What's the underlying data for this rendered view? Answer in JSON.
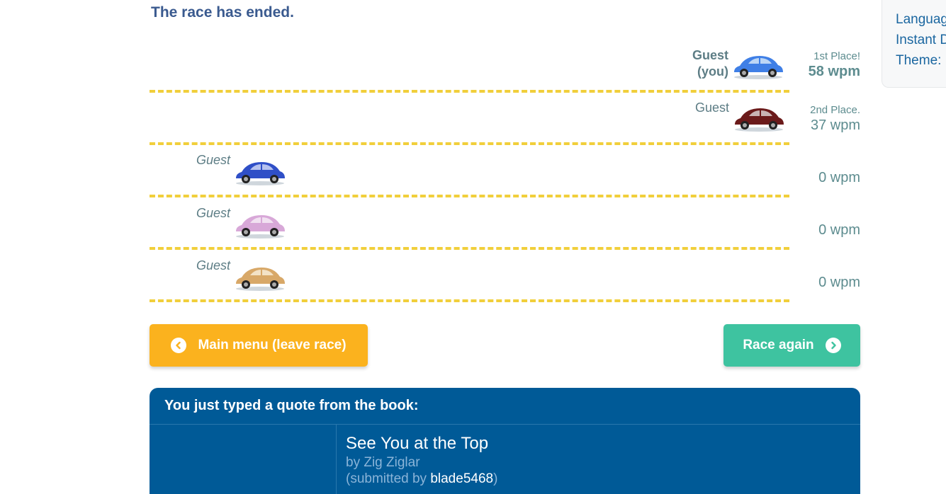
{
  "status": "The race has ended.",
  "settings": {
    "language_label": "Languag",
    "instant_label": "Instant D",
    "theme_label": "Theme:"
  },
  "racers": [
    {
      "name": "Guest",
      "tag": "(you)",
      "rank": "1st Place!",
      "wpm": "58 wpm",
      "car_color": "#3f7fe6"
    },
    {
      "name": "Guest",
      "tag": "",
      "rank": "2nd Place.",
      "wpm": "37 wpm",
      "car_color": "#6b1a1a"
    },
    {
      "name": "Guest",
      "tag": "",
      "rank": "",
      "wpm": "0 wpm",
      "car_color": "#2f4fc7"
    },
    {
      "name": "Guest",
      "tag": "",
      "rank": "",
      "wpm": "0 wpm",
      "car_color": "#d8a8d8"
    },
    {
      "name": "Guest",
      "tag": "",
      "rank": "",
      "wpm": "0 wpm",
      "car_color": "#d8a868"
    }
  ],
  "buttons": {
    "main_menu": "Main menu (leave race)",
    "race_again": "Race again"
  },
  "quote": {
    "header": "You just typed a quote from the book:",
    "title": "See You at the Top",
    "author": "by Zig Ziglar",
    "submitted_prefix": "(submitted by ",
    "submitted_user": "blade5468",
    "submitted_suffix": ")"
  },
  "colors": {
    "accent_orange": "#fbb21e",
    "accent_green": "#3ec3a0",
    "quote_blue": "#005a97",
    "track_dash": "#f1cf3b"
  }
}
